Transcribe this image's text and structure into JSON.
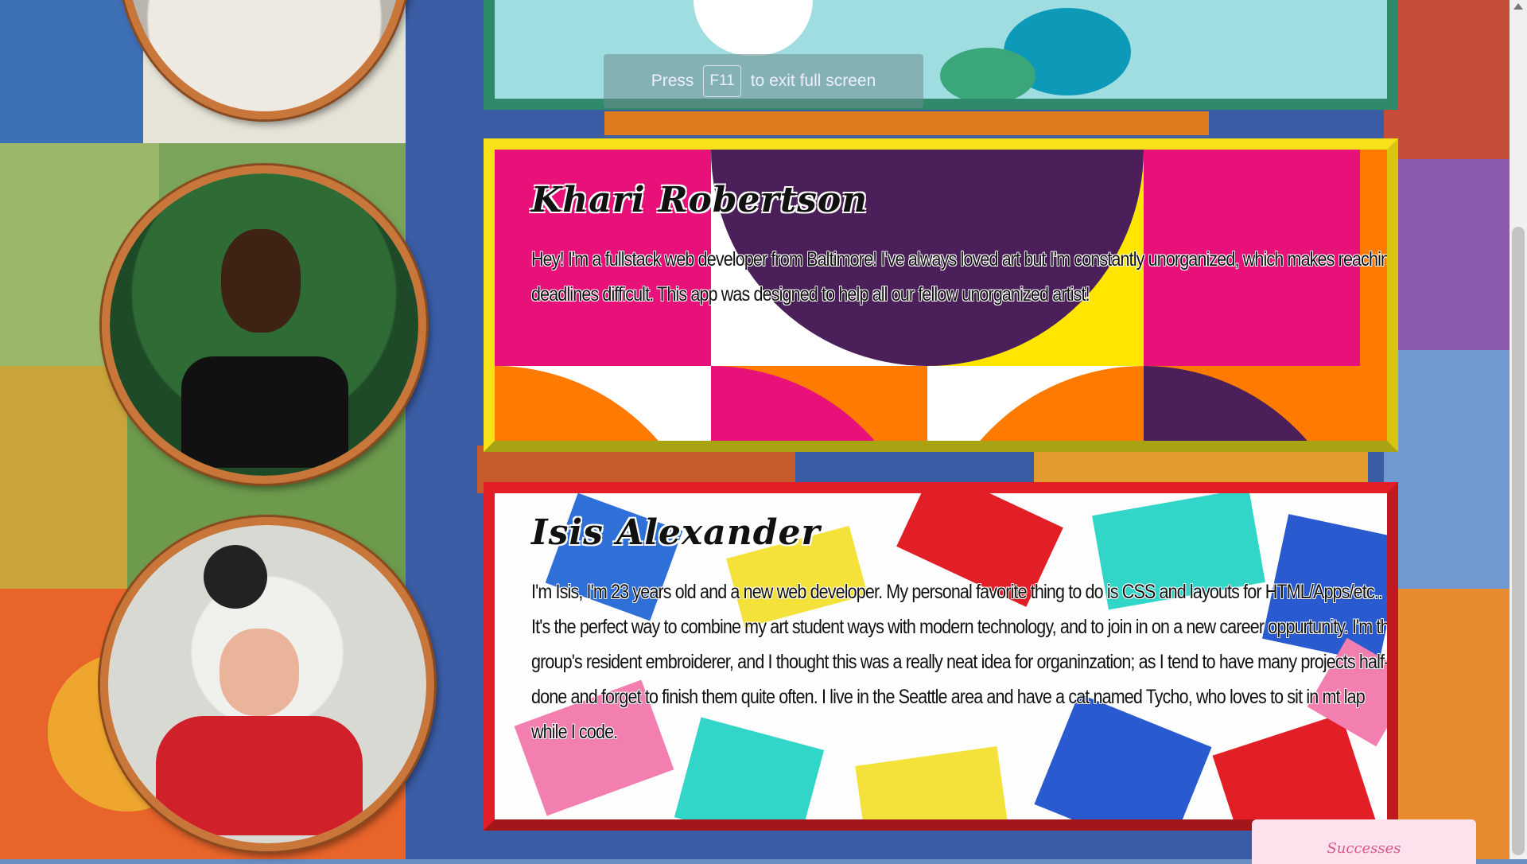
{
  "fullscreen_notice": {
    "press": "Press",
    "key": "F11",
    "message": "to exit full screen"
  },
  "team": [
    {
      "name": "Khari Robertson",
      "bio": "Hey! I'm a fullstack web developer from Baltimore! I've always loved art but I'm constantly unorganized, which makes reaching deadlines difficult. This app was designed to help all our fellow unorganized artist!"
    },
    {
      "name": "Isis Alexander",
      "bio": "I'm Isis, I'm 23 years old and a new web developer. My personal favorite thing to do is CSS and layouts for HTML/Apps/etc.. It's the perfect way to combine my art student ways with modern technology, and to join in on a new career oppurtunity. I'm the group's resident embroiderer, and I thought this was a really neat idea for organinzation; as I tend to have many projects half-done and forget to finish them quite often. I live in the Seattle area and have a cat named Tycho, who loves to sit in mt lap while I code."
    }
  ],
  "tabs": {
    "successes": "Successes"
  },
  "colors": {
    "card1_border": "#f7e21a",
    "card2_border": "#e21f26",
    "card0_border": "#2f8a6c",
    "hoop": "#c8763a"
  }
}
